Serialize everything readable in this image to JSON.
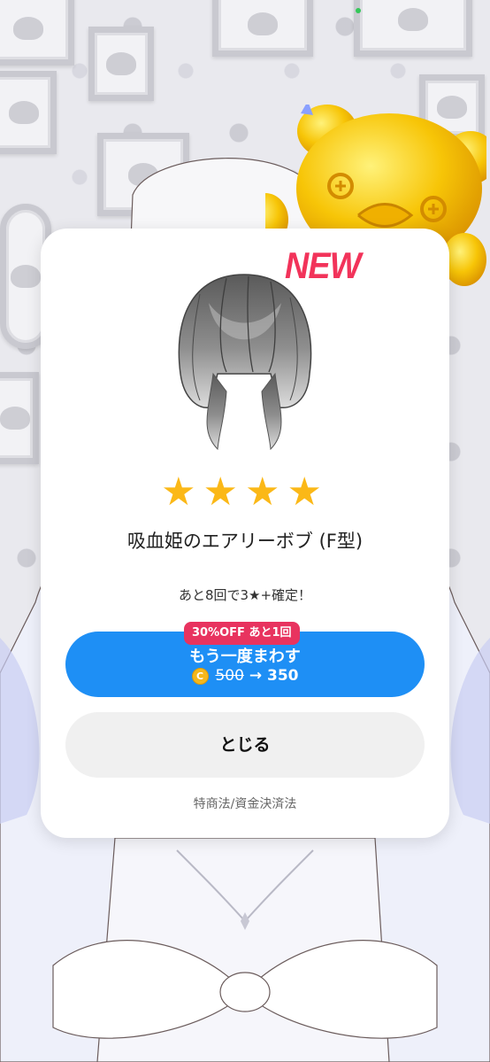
{
  "modal": {
    "new_badge": "NEW",
    "item_name": "吸血姫のエアリーボブ (F型)",
    "rarity_stars": 4,
    "guarantee_text": "あと8回で3★+確定！",
    "discount_badge": "30%OFF あと1回",
    "spin_button": {
      "label": "もう一度まわす",
      "coin_icon": "coin-icon",
      "original_price": "500",
      "arrow": "→",
      "discounted_price": "350"
    },
    "close_button": "とじる",
    "legal_link": "特商法/資金決済法"
  },
  "colors": {
    "new_badge": "#f2335a",
    "star": "#fbb817",
    "spin_button": "#1e8ff5",
    "discount_badge": "#e8335f",
    "close_button": "#f0f0f0"
  }
}
